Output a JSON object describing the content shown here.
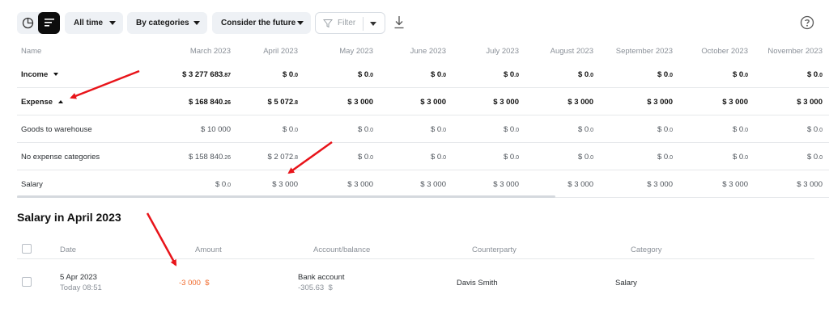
{
  "toolbar": {
    "period": "All time",
    "group_by": "By categories",
    "future": "Consider the future",
    "filter": "Filter"
  },
  "icons": {
    "chart_view": "pie-chart-icon",
    "list_view": "list-icon",
    "filter": "funnel-icon",
    "download": "download-icon",
    "help": "help-icon"
  },
  "table": {
    "name_header": "Name",
    "columns": [
      "March 2023",
      "April 2023",
      "May 2023",
      "June 2023",
      "July 2023",
      "August 2023",
      "September 2023",
      "October 2023",
      "November 2023"
    ],
    "rows": [
      {
        "name": "Income",
        "bold": true,
        "toggle": "down",
        "cells": [
          {
            "main": "$ 3 277 683",
            "cents": ".87"
          },
          {
            "main": "$ 0",
            "cents": ".0"
          },
          {
            "main": "$ 0",
            "cents": ".0"
          },
          {
            "main": "$ 0",
            "cents": ".0"
          },
          {
            "main": "$ 0",
            "cents": ".0"
          },
          {
            "main": "$ 0",
            "cents": ".0"
          },
          {
            "main": "$ 0",
            "cents": ".0"
          },
          {
            "main": "$ 0",
            "cents": ".0"
          },
          {
            "main": "$ 0",
            "cents": ".0"
          }
        ]
      },
      {
        "name": "Expense",
        "bold": true,
        "toggle": "up",
        "cells": [
          {
            "main": "$ 168 840",
            "cents": ".26"
          },
          {
            "main": "$ 5 072",
            "cents": ".8"
          },
          {
            "main": "$ 3 000",
            "cents": ""
          },
          {
            "main": "$ 3 000",
            "cents": ""
          },
          {
            "main": "$ 3 000",
            "cents": ""
          },
          {
            "main": "$ 3 000",
            "cents": ""
          },
          {
            "main": "$ 3 000",
            "cents": ""
          },
          {
            "main": "$ 3 000",
            "cents": ""
          },
          {
            "main": "$ 3 000",
            "cents": ""
          }
        ]
      },
      {
        "name": "Goods to warehouse",
        "bold": false,
        "toggle": "",
        "cells": [
          {
            "main": "$ 10 000",
            "cents": ""
          },
          {
            "main": "$ 0",
            "cents": ".0"
          },
          {
            "main": "$ 0",
            "cents": ".0"
          },
          {
            "main": "$ 0",
            "cents": ".0"
          },
          {
            "main": "$ 0",
            "cents": ".0"
          },
          {
            "main": "$ 0",
            "cents": ".0"
          },
          {
            "main": "$ 0",
            "cents": ".0"
          },
          {
            "main": "$ 0",
            "cents": ".0"
          },
          {
            "main": "$ 0",
            "cents": ".0"
          }
        ]
      },
      {
        "name": "No expense categories",
        "bold": false,
        "toggle": "",
        "cells": [
          {
            "main": "$ 158 840",
            "cents": ".26"
          },
          {
            "main": "$ 2 072",
            "cents": ".8"
          },
          {
            "main": "$ 0",
            "cents": ".0"
          },
          {
            "main": "$ 0",
            "cents": ".0"
          },
          {
            "main": "$ 0",
            "cents": ".0"
          },
          {
            "main": "$ 0",
            "cents": ".0"
          },
          {
            "main": "$ 0",
            "cents": ".0"
          },
          {
            "main": "$ 0",
            "cents": ".0"
          },
          {
            "main": "$ 0",
            "cents": ".0"
          }
        ]
      },
      {
        "name": "Salary",
        "bold": false,
        "toggle": "",
        "cells": [
          {
            "main": "$ 0",
            "cents": ".0"
          },
          {
            "main": "$ 3 000",
            "cents": ""
          },
          {
            "main": "$ 3 000",
            "cents": ""
          },
          {
            "main": "$ 3 000",
            "cents": ""
          },
          {
            "main": "$ 3 000",
            "cents": ""
          },
          {
            "main": "$ 3 000",
            "cents": ""
          },
          {
            "main": "$ 3 000",
            "cents": ""
          },
          {
            "main": "$ 3 000",
            "cents": ""
          },
          {
            "main": "$ 3 000",
            "cents": ""
          }
        ]
      }
    ]
  },
  "detail": {
    "title": "Salary in April 2023",
    "headers": {
      "date": "Date",
      "amount": "Amount",
      "account": "Account/balance",
      "counterparty": "Counterparty",
      "category": "Category"
    },
    "transaction": {
      "date": "5 Apr 2023",
      "time": "Today 08:51",
      "amount": "-3 000",
      "currency": "$",
      "account": "Bank account",
      "balance": "-305.63",
      "balance_currency": "$",
      "counterparty": "Davis Smith",
      "category": "Salary"
    }
  },
  "colors": {
    "negative_amount": "#f06a2c",
    "annotation_arrow": "#e8141a",
    "button_bg": "#eef1f5"
  }
}
